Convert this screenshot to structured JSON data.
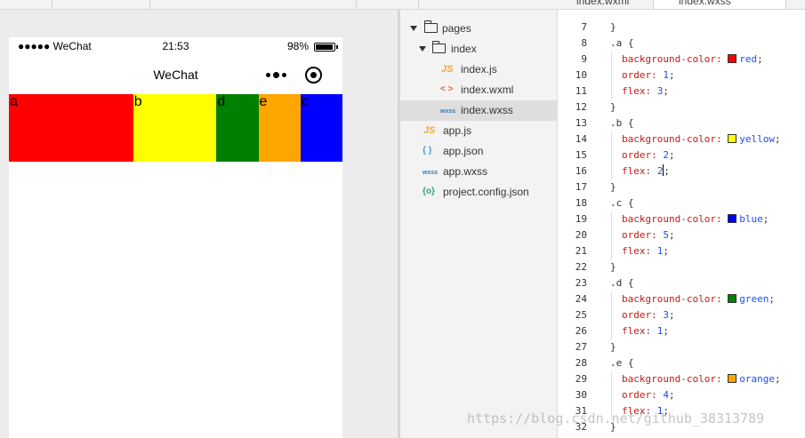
{
  "topbar": {
    "tabs": [
      {
        "label": "index.wxml"
      },
      {
        "label": "index.wxss"
      }
    ]
  },
  "simulator": {
    "status": {
      "carrier": "●●●●● WeChat",
      "time": "21:53",
      "battery": "98%"
    },
    "nav_title": "WeChat",
    "flex_items": [
      {
        "label": "a",
        "color": "#ff0000",
        "flex": 3
      },
      {
        "label": "b",
        "color": "#ffff00",
        "flex": 2
      },
      {
        "label": "d",
        "color": "#008000",
        "flex": 1
      },
      {
        "label": "e",
        "color": "#ffa500",
        "flex": 1
      },
      {
        "label": "c",
        "color": "#0000ff",
        "flex": 1
      }
    ]
  },
  "file_tree": [
    {
      "label": "pages",
      "type": "folder",
      "expanded": true
    },
    {
      "label": "index",
      "type": "folder",
      "expanded": true
    },
    {
      "label": "index.js",
      "type": "js",
      "icon": "JS"
    },
    {
      "label": "index.wxml",
      "type": "wxml",
      "icon": "< >"
    },
    {
      "label": "index.wxss",
      "type": "wxss",
      "icon": "wxss",
      "selected": true
    },
    {
      "label": "app.js",
      "type": "js",
      "icon": "JS"
    },
    {
      "label": "app.json",
      "type": "json",
      "icon": "{ }"
    },
    {
      "label": "app.wxss",
      "type": "wxss",
      "icon": "wxss"
    },
    {
      "label": "project.config.json",
      "type": "config",
      "icon": "{o}"
    }
  ],
  "editor": {
    "lines": [
      {
        "n": "7",
        "text": "}"
      },
      {
        "n": "8",
        "text": ".a {"
      },
      {
        "n": "9",
        "prop": "background-color:",
        "value": "red",
        "swatch": "#ff0000"
      },
      {
        "n": "10",
        "prop": "order:",
        "value": "1"
      },
      {
        "n": "11",
        "prop": "flex:",
        "value": "3"
      },
      {
        "n": "12",
        "text": "}"
      },
      {
        "n": "13",
        "text": ".b {"
      },
      {
        "n": "14",
        "prop": "background-color:",
        "value": "yellow",
        "swatch": "#ffff00"
      },
      {
        "n": "15",
        "prop": "order:",
        "value": "2"
      },
      {
        "n": "16",
        "prop": "flex:",
        "value": "2",
        "cursor": true
      },
      {
        "n": "17",
        "text": "}"
      },
      {
        "n": "18",
        "text": ".c {"
      },
      {
        "n": "19",
        "prop": "background-color:",
        "value": "blue",
        "swatch": "#0000ff"
      },
      {
        "n": "20",
        "prop": "order:",
        "value": "5"
      },
      {
        "n": "21",
        "prop": "flex:",
        "value": "1"
      },
      {
        "n": "22",
        "text": "}"
      },
      {
        "n": "23",
        "text": ".d {"
      },
      {
        "n": "24",
        "prop": "background-color:",
        "value": "green",
        "swatch": "#008000"
      },
      {
        "n": "25",
        "prop": "order:",
        "value": "3"
      },
      {
        "n": "26",
        "prop": "flex:",
        "value": "1"
      },
      {
        "n": "27",
        "text": "}"
      },
      {
        "n": "28",
        "text": ".e {"
      },
      {
        "n": "29",
        "prop": "background-color:",
        "value": "orange",
        "swatch": "#ffa500"
      },
      {
        "n": "30",
        "prop": "order:",
        "value": "4"
      },
      {
        "n": "31",
        "prop": "flex:",
        "value": "1"
      },
      {
        "n": "32",
        "text": "}"
      }
    ]
  },
  "watermark": "https://blog.csdn.net/github_38313789"
}
